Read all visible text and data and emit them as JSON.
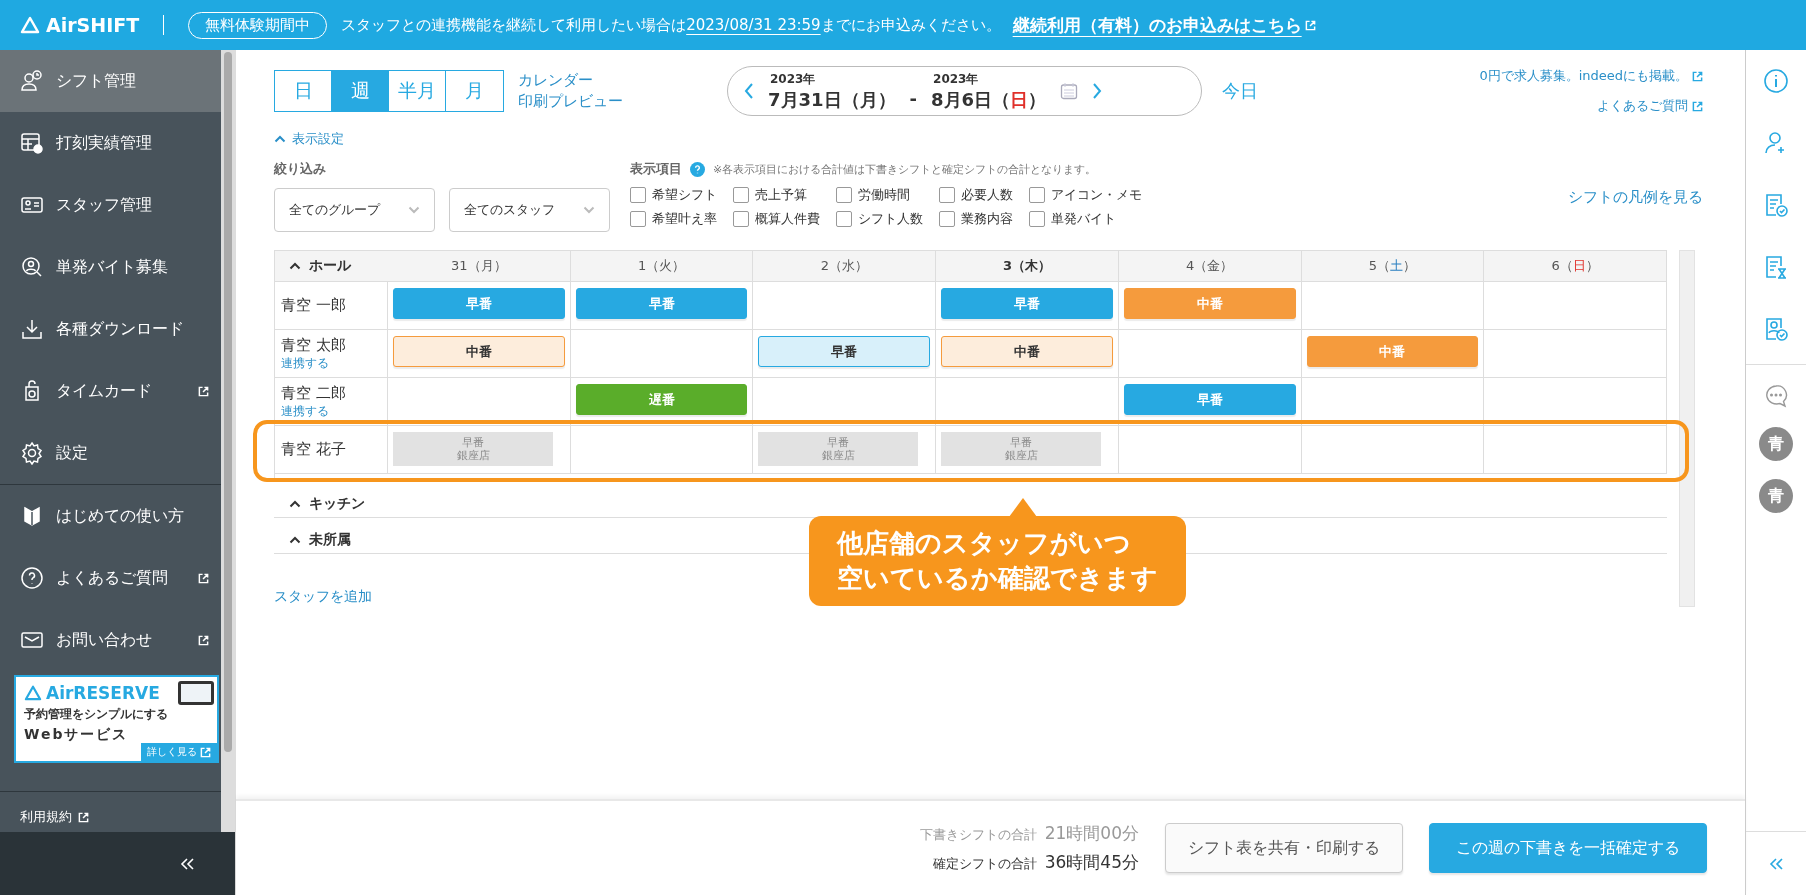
{
  "top_bar": {
    "logo": "AirSHIFT",
    "trial_badge": "無料体験期間中",
    "notice_pre": "スタッフとの連携機能を継続して利用したい場合は",
    "notice_date": "2023/08/31 23:59",
    "notice_post": "までにお申込みください。",
    "apply_link": "継続利用（有料）のお申込みはこちら"
  },
  "sidebar": {
    "sections": [
      [
        {
          "label": "シフト管理",
          "selected": true,
          "external": false
        },
        {
          "label": "打刻実績管理",
          "selected": false,
          "external": false
        },
        {
          "label": "スタッフ管理",
          "selected": false,
          "external": false
        },
        {
          "label": "単発バイト募集",
          "selected": false,
          "external": false
        },
        {
          "label": "各種ダウンロード",
          "selected": false,
          "external": false
        },
        {
          "label": "タイムカード",
          "selected": false,
          "external": true
        },
        {
          "label": "設定",
          "selected": false,
          "external": false
        }
      ],
      [
        {
          "label": "はじめての使い方",
          "selected": false,
          "external": false
        },
        {
          "label": "よくあるご質問",
          "selected": false,
          "external": true
        },
        {
          "label": "お問い合わせ",
          "selected": false,
          "external": true
        }
      ]
    ],
    "banner": {
      "logo": "AirRESERVE",
      "tagline": "予約管理をシンプルにする",
      "headline": "Webサービス",
      "more": "詳しく見る"
    },
    "terms_link": "利用規約"
  },
  "view_tabs": [
    {
      "label": "日",
      "selected": false
    },
    {
      "label": "週",
      "selected": true
    },
    {
      "label": "半月",
      "selected": false
    },
    {
      "label": "月",
      "selected": false
    }
  ],
  "print_preview_link": [
    "カレンダー",
    "印刷プレビュー"
  ],
  "date_range": {
    "start_year": "2023年",
    "start": "7月31日（月）",
    "separator": "-",
    "end_year": "2023年",
    "end_pre": "8月6日（",
    "end_dow": "日",
    "end_post": "）"
  },
  "today_button": "今日",
  "top_links": [
    "0円で求人募集。indeedにも掲載。",
    "よくあるご質問"
  ],
  "display_settings": {
    "label": "表示設定",
    "expanded": true
  },
  "filter": {
    "label": "絞り込み",
    "selects": [
      "全てのグループ",
      "全てのスタッフ"
    ]
  },
  "display_items": {
    "label": "表示項目",
    "note": "※各表示項目における合計値は下書きシフトと確定シフトの合計となります。",
    "options": [
      {
        "label": "希望シフト",
        "checked": false
      },
      {
        "label": "売上予算",
        "checked": false
      },
      {
        "label": "労働時間",
        "checked": false
      },
      {
        "label": "必要人数",
        "checked": false
      },
      {
        "label": "アイコン・メモ",
        "checked": false
      },
      {
        "label": "希望叶え率",
        "checked": false
      },
      {
        "label": "概算人件費",
        "checked": false
      },
      {
        "label": "シフト人数",
        "checked": false
      },
      {
        "label": "業務内容",
        "checked": false
      },
      {
        "label": "単発バイト",
        "checked": false
      }
    ]
  },
  "legend_link": "シフトの凡例を見る",
  "days": [
    {
      "pre": "31（",
      "dow": "月",
      "post": "）",
      "kind": "weekday",
      "today": false
    },
    {
      "pre": "1（",
      "dow": "火",
      "post": "）",
      "kind": "weekday",
      "today": false
    },
    {
      "pre": "2（",
      "dow": "水",
      "post": "）",
      "kind": "weekday",
      "today": false
    },
    {
      "pre": "3（",
      "dow": "木",
      "post": "）",
      "kind": "weekday",
      "today": true
    },
    {
      "pre": "4（",
      "dow": "金",
      "post": "）",
      "kind": "weekday",
      "today": false
    },
    {
      "pre": "5（",
      "dow": "土",
      "post": "）",
      "kind": "saturday",
      "today": false
    },
    {
      "pre": "6（",
      "dow": "日",
      "post": "）",
      "kind": "sunday",
      "today": false
    }
  ],
  "groups": [
    {
      "name": "ホール",
      "expanded": true,
      "staff": [
        {
          "name": "青空 一郎",
          "highlighted": false,
          "cells": [
            {
              "label": "早番",
              "kind": "confirmed",
              "color": "#27a9e1"
            },
            {
              "label": "早番",
              "kind": "confirmed",
              "color": "#27a9e1"
            },
            null,
            {
              "label": "早番",
              "kind": "confirmed",
              "color": "#27a9e1"
            },
            {
              "label": "中番",
              "kind": "confirmed",
              "color": "#f59b3d"
            },
            null,
            null
          ]
        },
        {
          "name": "青空 太郎",
          "link": "連携する",
          "highlighted": false,
          "cells": [
            {
              "label": "中番",
              "kind": "draft",
              "color": "#f59b3d"
            },
            null,
            {
              "label": "早番",
              "kind": "draft",
              "color": "#27a9e1"
            },
            {
              "label": "中番",
              "kind": "draft",
              "color": "#f59b3d"
            },
            null,
            {
              "label": "中番",
              "kind": "confirmed",
              "color": "#f59b3d"
            },
            null
          ]
        },
        {
          "name": "青空 二郎",
          "link": "連携する",
          "highlighted": false,
          "cells": [
            null,
            {
              "label": "遅番",
              "kind": "confirmed",
              "color": "#5aad2a"
            },
            null,
            null,
            {
              "label": "早番",
              "kind": "confirmed",
              "color": "#27a9e1"
            },
            null,
            null
          ]
        },
        {
          "name": "青空 花子",
          "highlighted": true,
          "cells": [
            {
              "label": "早番",
              "store": "銀座店",
              "kind": "other_store"
            },
            null,
            {
              "label": "早番",
              "store": "銀座店",
              "kind": "other_store"
            },
            {
              "label": "早番",
              "store": "銀座店",
              "kind": "other_store"
            },
            null,
            null,
            null
          ]
        }
      ]
    },
    {
      "name": "キッチン",
      "expanded": true
    },
    {
      "name": "未所属",
      "expanded": true
    }
  ],
  "callout": [
    "他店舗のスタッフがいつ",
    "空いているか確認できます"
  ],
  "add_staff_link": "スタッフを追加",
  "totals": [
    {
      "label": "下書きシフトの合計",
      "value": "21時間00分",
      "kind": "draft"
    },
    {
      "label": "確定シフトの合計",
      "value": "36時間45分",
      "kind": "confirmed"
    }
  ],
  "share_button": "シフト表を共有・印刷する",
  "confirm_button": "この週の下書きを一括確定する",
  "right_rail": {
    "avatars": [
      "青",
      "青"
    ]
  }
}
